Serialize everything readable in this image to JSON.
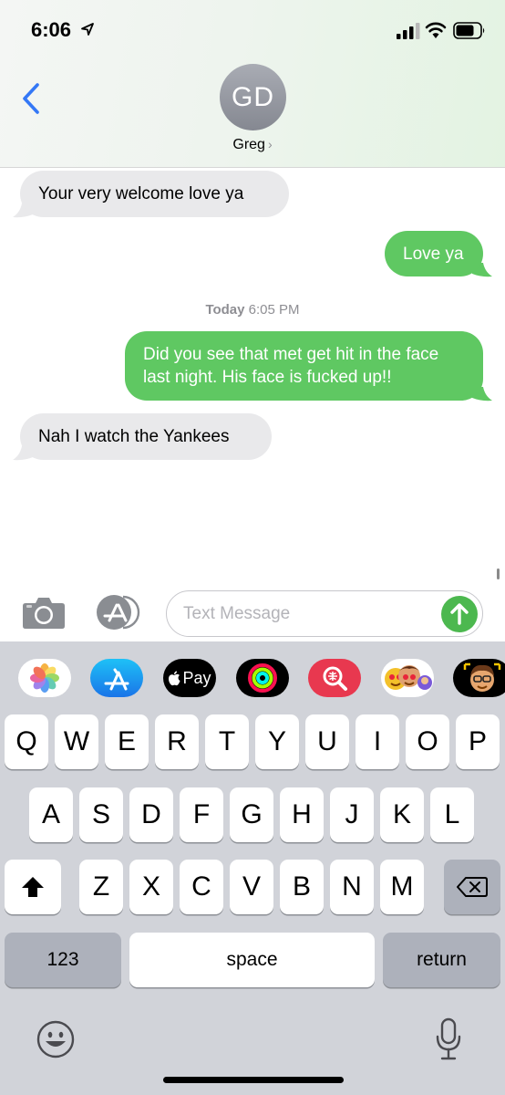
{
  "status_bar": {
    "time": "6:06"
  },
  "contact": {
    "initials": "GD",
    "name": "Greg",
    "chevron": "›"
  },
  "messages": [
    {
      "direction": "incoming",
      "text": "Your very welcome love ya"
    },
    {
      "direction": "outgoing",
      "text": "Love ya"
    },
    {
      "direction": "outgoing",
      "text": "Did you see that met get hit in the face last night. His face is fucked up!!"
    },
    {
      "direction": "incoming",
      "text": "Nah I watch the Yankees"
    }
  ],
  "timestamp": {
    "day": "Today",
    "time": "6:05 PM"
  },
  "compose": {
    "placeholder": "Text Message",
    "value": ""
  },
  "app_strip": [
    "photos-app-icon",
    "app-store-icon",
    "apple-pay-icon",
    "activity-icon",
    "web-search-icon",
    "memoji-stickers-icon",
    "animoji-icon"
  ],
  "apple_pay_label": "Pay",
  "keyboard": {
    "row1": [
      "Q",
      "W",
      "E",
      "R",
      "T",
      "Y",
      "U",
      "I",
      "O",
      "P"
    ],
    "row2": [
      "A",
      "S",
      "D",
      "F",
      "G",
      "H",
      "J",
      "K",
      "L"
    ],
    "row3": [
      "Z",
      "X",
      "C",
      "V",
      "B",
      "N",
      "M"
    ],
    "numbers_label": "123",
    "space_label": "space",
    "return_label": "return"
  },
  "colors": {
    "outgoing_bubble": "#5fc862",
    "incoming_bubble": "#e9e9eb",
    "accent": "#3478f6",
    "send": "#4cb84f"
  }
}
